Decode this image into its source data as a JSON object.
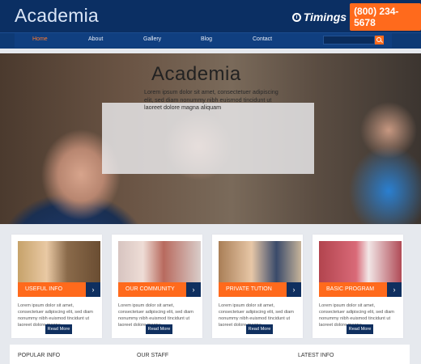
{
  "header": {
    "logo": "Academia",
    "timings_label": "Timings",
    "phone": "(800) 234-5678",
    "icons": {
      "clock": "clock-icon",
      "search": "search-icon",
      "arrow": "chevron-right-icon"
    }
  },
  "nav": {
    "items": [
      {
        "label": "Home",
        "active": true
      },
      {
        "label": "About",
        "active": false
      },
      {
        "label": "Gallery",
        "active": false
      },
      {
        "label": "Blog",
        "active": false
      },
      {
        "label": "Contact",
        "active": false
      }
    ],
    "search_placeholder": ""
  },
  "hero": {
    "title": "Academia",
    "text": "Lorem ipsum dolor sit amet, consectetuer adipiscing elit, sed diam nonummy nibh euismod tincidunt ut laoreet dolore magna aliquam"
  },
  "cards": [
    {
      "caption": "USEFUL INFO",
      "desc": "Lorem ipsum dolor sit amet, consectetuer adipiscing elit, sed diam nonummy nibh euismod tincidunt ut laoreet dolore magna",
      "button": "Read More"
    },
    {
      "caption": "OUR COMMUNITY",
      "desc": "Lorem ipsum dolor sit amet, consectetuer adipiscing elit, sed diam nonummy nibh euismod tincidunt ut laoreet dolore magna",
      "button": "Read More"
    },
    {
      "caption": "PRIVATE TUTION",
      "desc": "Lorem ipsum dolor sit amet, consectetuer adipiscing elit, sed diam nonummy nibh euismod tincidunt ut laoreet dolore magna",
      "button": "Read More"
    },
    {
      "caption": "BASIC PROGRAM",
      "desc": "Lorem ipsum dolor sit amet, consectetuer adipiscing elit, sed diam nonummy nibh euismod tincidunt ut laoreet dolore magna",
      "button": "Read More"
    }
  ],
  "bottom": {
    "headings": [
      "POPULAR INFO",
      "OUR STAFF",
      "LATEST INFO"
    ]
  },
  "colors": {
    "header_bg": "#0b2f63",
    "accent": "#ff6a1c",
    "dark_button": "#0f2f5f"
  }
}
